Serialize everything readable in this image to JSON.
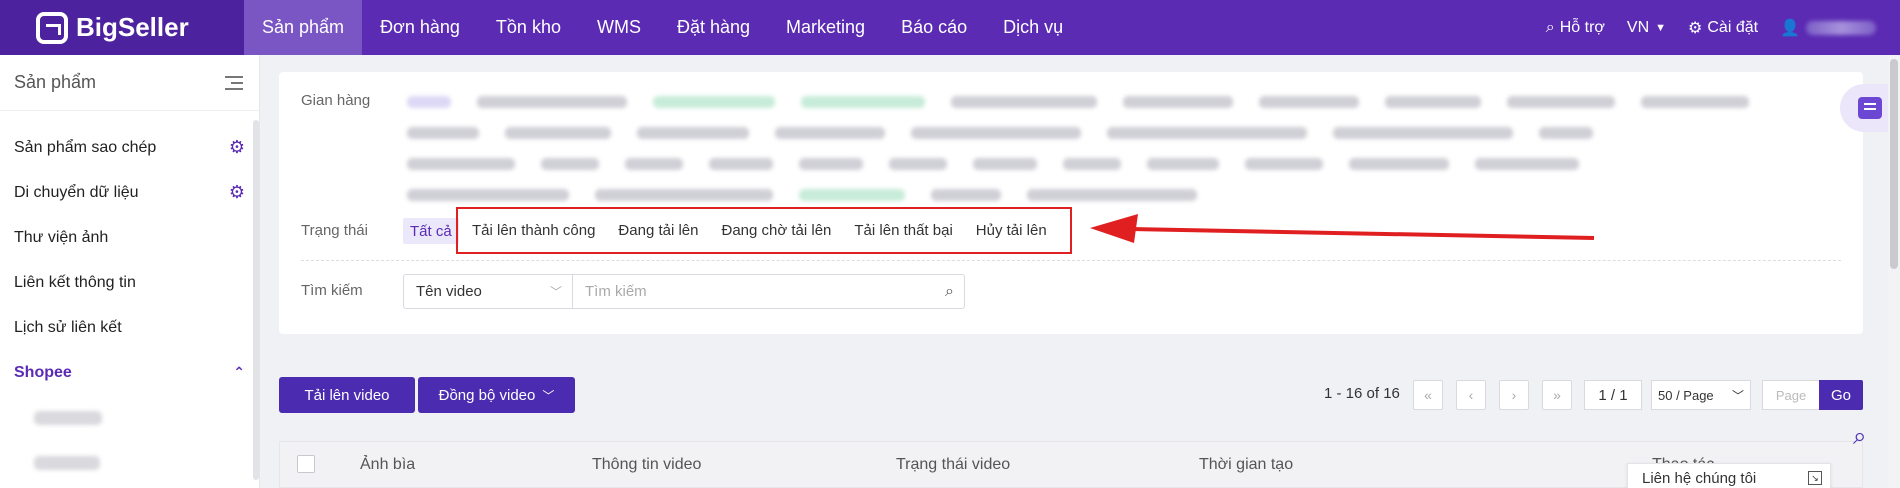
{
  "app": {
    "brand": "BigSeller"
  },
  "nav": {
    "items": [
      "Sản phẩm",
      "Đơn hàng",
      "Tồn kho",
      "WMS",
      "Đặt hàng",
      "Marketing",
      "Báo cáo",
      "Dịch vụ"
    ],
    "active": "Sản phẩm",
    "support": "Hỗ trợ",
    "language": "VN",
    "settings": "Cài đặt"
  },
  "sidebar": {
    "title": "Sản phẩm",
    "items": [
      {
        "label": "Sản phẩm sao chép",
        "icon": "gear-icon"
      },
      {
        "label": "Di chuyển dữ liệu",
        "icon": "gear-icon"
      },
      {
        "label": "Thư viện ảnh"
      },
      {
        "label": "Liên kết thông tin"
      },
      {
        "label": "Lịch sử liên kết"
      }
    ],
    "group": {
      "label": "Shopee",
      "expanded": true
    }
  },
  "filter": {
    "shop_label": "Gian hàng",
    "status_label": "Trạng thái",
    "status_all": "Tất cả",
    "status_options": [
      "Tải lên thành công",
      "Đang tải lên",
      "Đang chờ tải lên",
      "Tải lên thất bại",
      "Hủy tải lên"
    ],
    "search_label": "Tìm kiếm",
    "search_field": "Tên video",
    "search_placeholder": "Tìm kiếm"
  },
  "toolbar": {
    "upload_button": "Tải lên video",
    "sync_button": "Đồng bộ video"
  },
  "pagination": {
    "range": "1 - 16 of 16",
    "current": "1 / 1",
    "page_size": "50 / Page",
    "page_placeholder": "Page",
    "go": "Go"
  },
  "table": {
    "columns": [
      "Ảnh bìa",
      "Thông tin video",
      "Trạng thái video",
      "Thời gian tạo",
      "Thao tác"
    ]
  },
  "contact": {
    "label": "Liên hệ chúng tôi"
  },
  "colors": {
    "brand": "#5b2bb3",
    "primary_button": "#4b2bb0",
    "highlight_box": "#e02020"
  }
}
